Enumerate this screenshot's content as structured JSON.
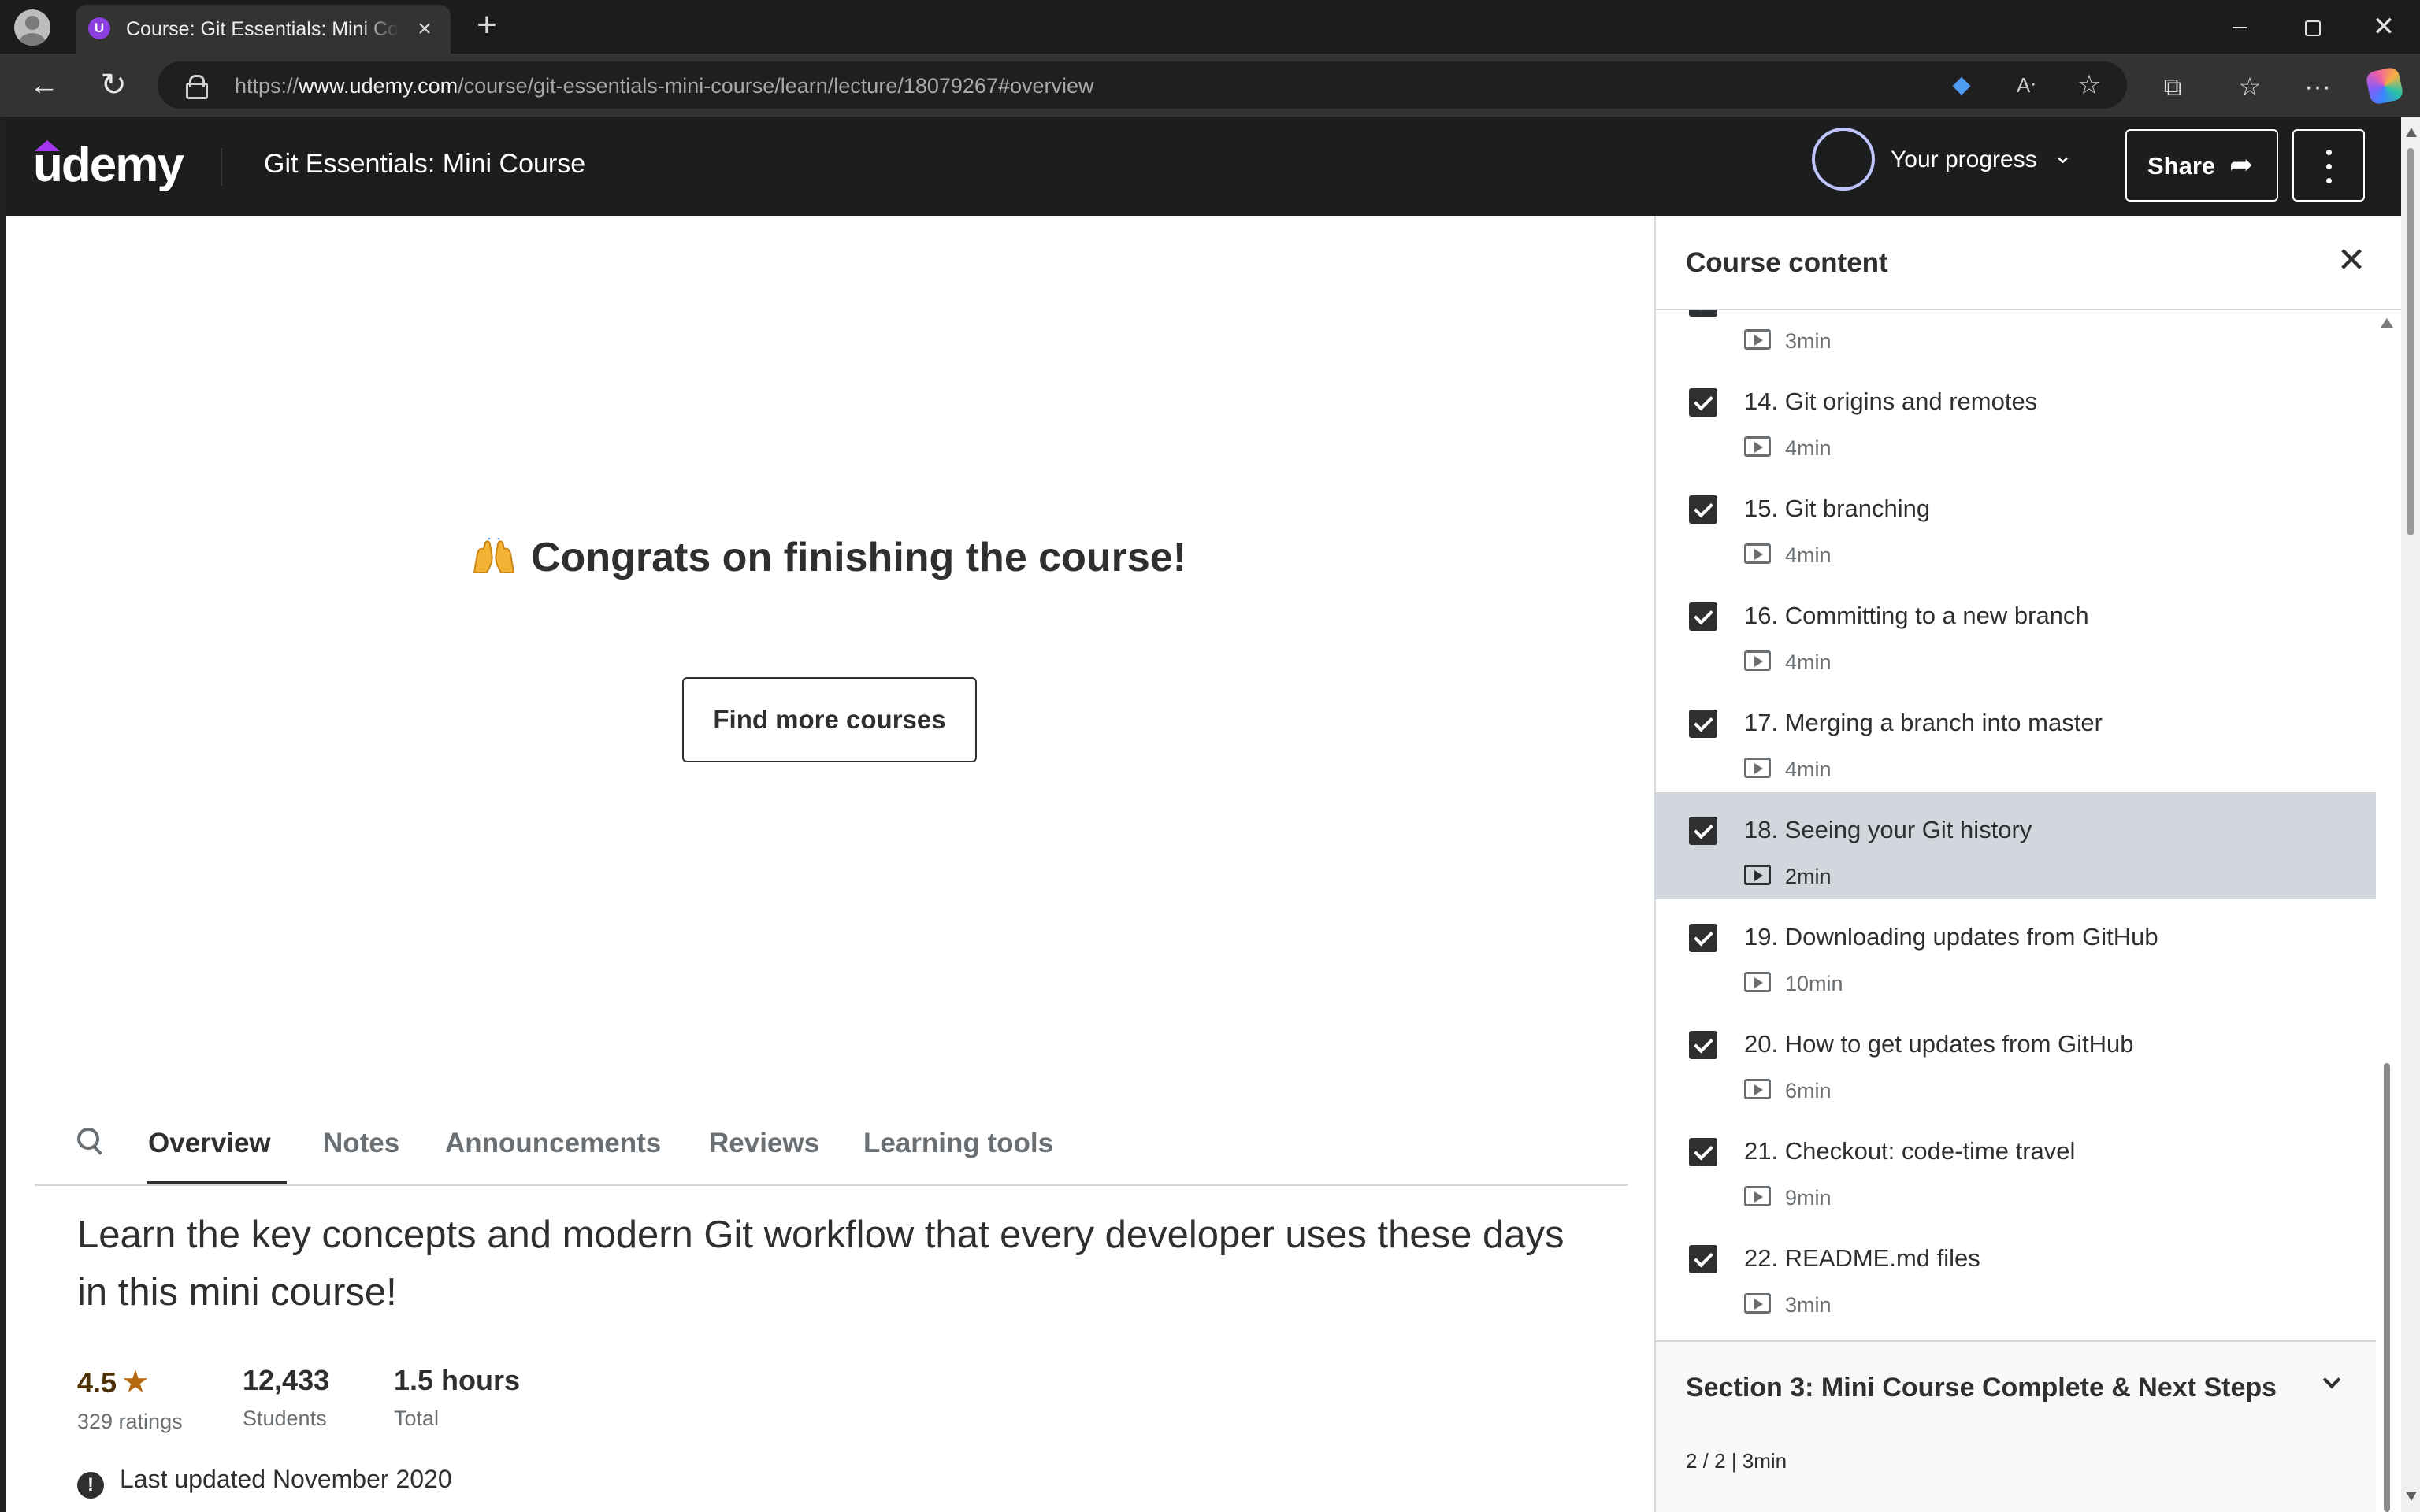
{
  "browser": {
    "tab_title": "Course: Git Essentials: Mini Course",
    "tab_favicon": "U",
    "url_prefix": "https://",
    "url_host": "www.udemy.com",
    "url_path": "/course/git-essentials-mini-course/learn/lecture/18079267#overview"
  },
  "header": {
    "logo": "udemy",
    "course_title": "Git Essentials: Mini Course",
    "progress_label": "Your progress",
    "share_label": "Share"
  },
  "main": {
    "congrats": "Congrats on finishing the course!",
    "find_more_label": "Find more courses",
    "tabs": [
      "Overview",
      "Notes",
      "Announcements",
      "Reviews",
      "Learning tools"
    ],
    "description": "Learn the key concepts and modern Git workflow that every developer uses these days in this mini course!",
    "stats": {
      "rating": "4.5",
      "ratings_label": "329 ratings",
      "students": "12,433",
      "students_label": "Students",
      "total": "1.5 hours",
      "total_label": "Total"
    },
    "last_updated": "Last updated November 2020"
  },
  "sidebar": {
    "title": "Course content",
    "partial_duration": "3min",
    "lectures": [
      {
        "title": "14. Git origins and remotes",
        "duration": "4min"
      },
      {
        "title": "15. Git branching",
        "duration": "4min"
      },
      {
        "title": "16. Committing to a new branch",
        "duration": "4min"
      },
      {
        "title": "17. Merging a branch into master",
        "duration": "4min"
      },
      {
        "title": "18. Seeing your Git history",
        "duration": "2min"
      },
      {
        "title": "19. Downloading updates from GitHub",
        "duration": "10min"
      },
      {
        "title": "20. How to get updates from GitHub",
        "duration": "6min"
      },
      {
        "title": "21. Checkout: code-time travel",
        "duration": "9min"
      },
      {
        "title": "22. README.md files",
        "duration": "3min"
      }
    ],
    "section3": {
      "title": "Section 3: Mini Course Complete & Next Steps",
      "meta": "2 / 2 | 3min"
    }
  },
  "colors": {
    "brand": "#a435f0",
    "header_bg": "#1c1d1f",
    "current_lecture_bg": "#d1d7dc",
    "star": "#b4690e"
  }
}
